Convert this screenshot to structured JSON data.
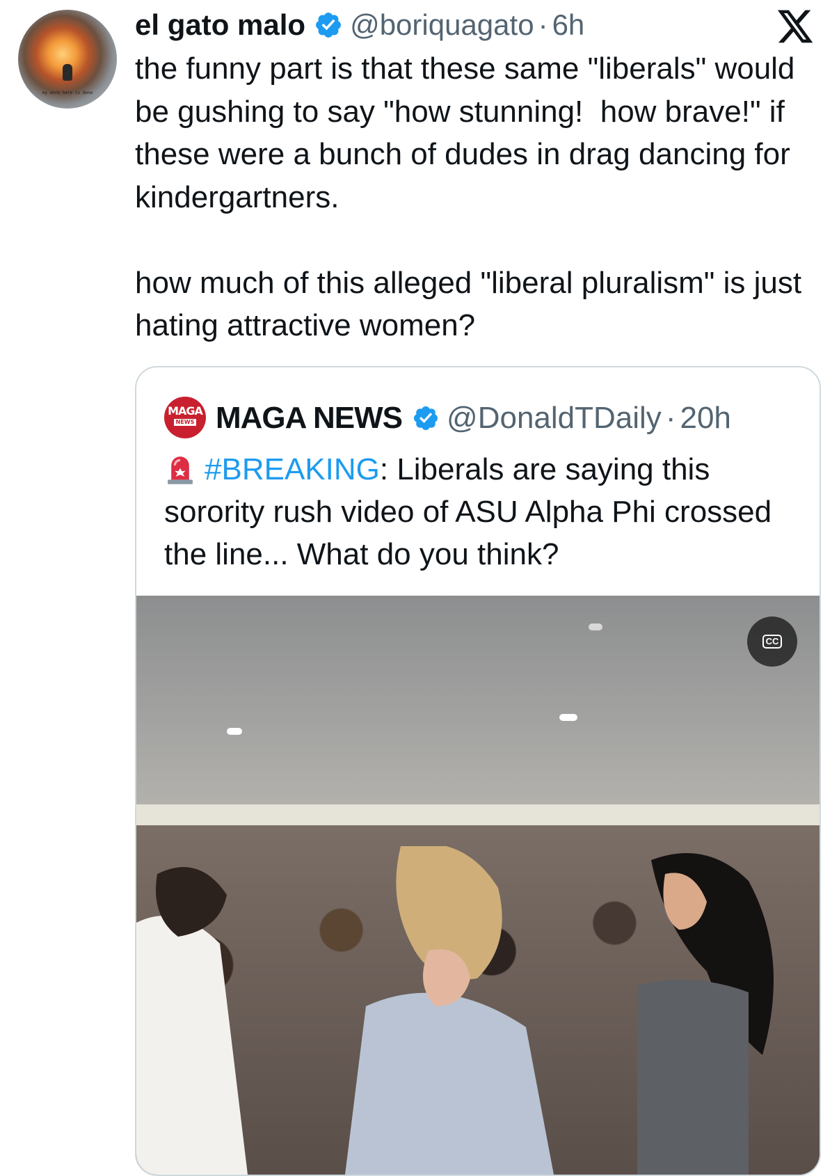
{
  "tweet": {
    "author_name": "el gato malo",
    "handle": "@boriquagato",
    "separator": "·",
    "time": "6h",
    "avatar_caption": "my work here is done",
    "paragraphs": [
      "the funny part is that these same \"liberals\" would be gushing to say \"how stunning!  how brave!\" if these were a bunch of dudes in drag dancing for kindergartners.",
      "how much of this alleged \"liberal pluralism\" is just hating attractive women?"
    ]
  },
  "quote": {
    "avatar_text_top": "MAGA",
    "avatar_text_bottom": "NEWS",
    "author_name": "MAGA NEWS",
    "handle": "@DonaldTDaily",
    "separator": "·",
    "time": "20h",
    "hashtag": "#BREAKING",
    "text_after_hashtag": ": Liberals are saying this sorority rush video of ASU Alpha Phi crossed the line... What do you think?",
    "media": {
      "captions_button_label": "CC"
    }
  },
  "icons": {
    "verified": "verified-badge-icon",
    "brand": "x-logo-icon",
    "siren": "rotating-light-icon"
  },
  "colors": {
    "verified_blue": "#1d9bf0",
    "hashtag_blue": "#1d9bf0",
    "secondary_text": "#536471",
    "primary_text": "#0f1419",
    "border": "#cfd9de"
  }
}
